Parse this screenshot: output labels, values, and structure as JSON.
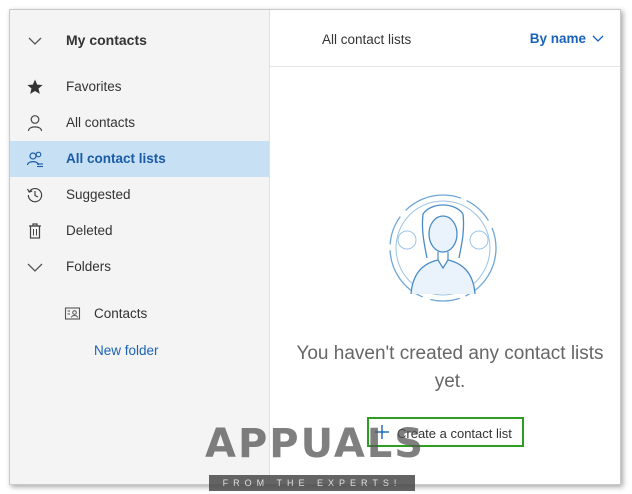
{
  "sidebar": {
    "title": "My contacts",
    "items": [
      {
        "label": "Favorites",
        "icon": "star-icon"
      },
      {
        "label": "All contacts",
        "icon": "person-icon"
      },
      {
        "label": "All contact lists",
        "icon": "people-list-icon",
        "active": true
      },
      {
        "label": "Suggested",
        "icon": "history-icon"
      },
      {
        "label": "Deleted",
        "icon": "trash-icon"
      },
      {
        "label": "Folders",
        "icon": "chevron-down-icon"
      }
    ],
    "folders": [
      {
        "label": "Contacts",
        "icon": "contact-card-icon"
      }
    ],
    "new_folder_label": "New folder"
  },
  "main": {
    "title": "All contact lists",
    "sort_label": "By name",
    "empty_message": "You haven't created any contact lists yet.",
    "create_button_label": "Create a contact list"
  },
  "watermark": {
    "brand": "APPUALS",
    "tagline": "FROM THE EXPERTS!"
  },
  "colors": {
    "accent": "#1a62b8",
    "active_bg": "#c7e0f4",
    "highlight_border": "#2e9e22"
  }
}
